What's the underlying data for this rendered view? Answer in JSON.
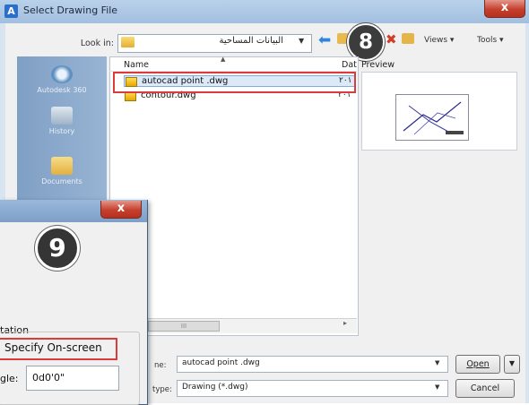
{
  "select_drawing_dialog": {
    "title": "Select Drawing File",
    "close_glyph": "x",
    "look_in_label": "Look in:",
    "look_in_value": "البيانات المساحية",
    "toolbar": {
      "views_label": "Views",
      "tools_label": "Tools"
    },
    "places": [
      {
        "label": "Autodesk 360",
        "icon": "autodesk-360-icon"
      },
      {
        "label": "History",
        "icon": "history-icon"
      },
      {
        "label": "Documents",
        "icon": "documents-icon"
      }
    ],
    "columns": {
      "name": "Name",
      "date": "Dat"
    },
    "files": [
      {
        "name": "autocad point .dwg",
        "date": "٢٠١",
        "selected": true,
        "icon": "dwg-file-icon"
      },
      {
        "name": "contour.dwg",
        "date": "٢٠١",
        "selected": false,
        "icon": "dwg-file-icon"
      }
    ],
    "preview_label": "Preview",
    "scroll_mark": "III",
    "file_name_label": "ne:",
    "file_name_value": "autocad point .dwg",
    "file_type_label": "type:",
    "file_type_value": "Drawing (*.dwg)",
    "open_button": "Open",
    "cancel_button": "Cancel"
  },
  "insert_dialog": {
    "close_glyph": "x",
    "rotation_label": "tation",
    "specify_on_screen_label": "Specify On-screen",
    "angle_label": "gle:",
    "angle_value": "0d0'0\""
  },
  "step_badges": {
    "badge_8": "8",
    "badge_9": "9"
  },
  "colors": {
    "highlight_border": "#dd3b3b",
    "title_bar": "#b9d1ea",
    "close_button": "#c6402d",
    "places_bar": "#8fadcf",
    "selected_row": "#dceaf8"
  }
}
